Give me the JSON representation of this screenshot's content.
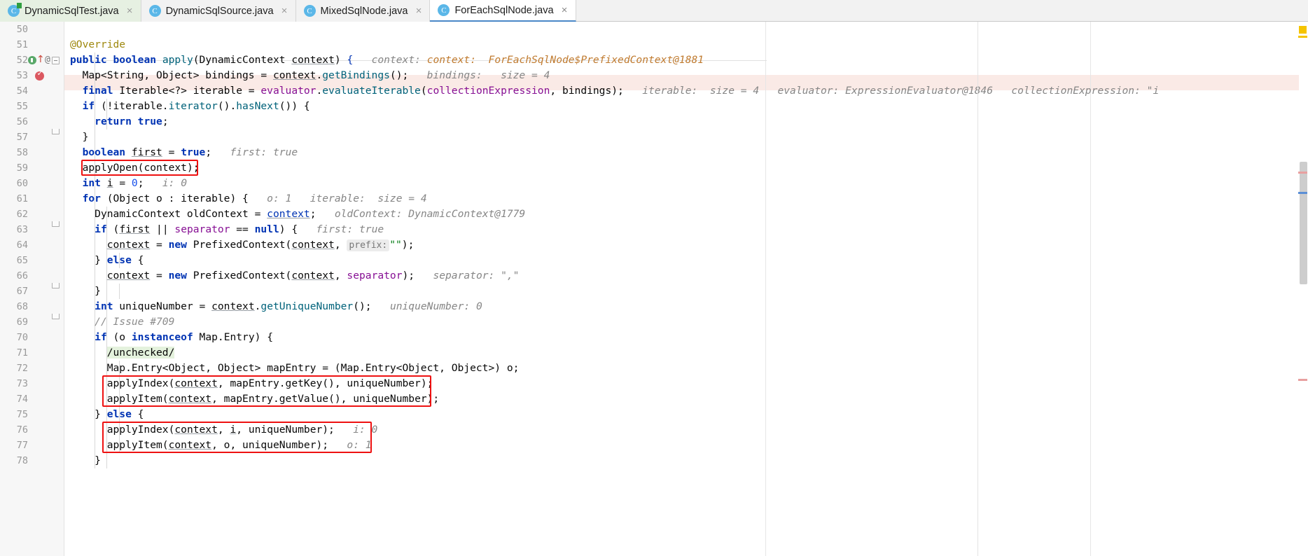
{
  "window": {
    "type": "ide-code-editor",
    "theme": "light"
  },
  "tabs": [
    {
      "label": "DynamicSqlTest.java",
      "icon": "java-class-icon",
      "state": "modified",
      "close": "×",
      "icon_letter": "C"
    },
    {
      "label": "DynamicSqlSource.java",
      "icon": "java-class-icon",
      "state": "normal",
      "close": "×",
      "icon_letter": "C"
    },
    {
      "label": "MixedSqlNode.java",
      "icon": "java-class-icon",
      "state": "normal",
      "close": "×",
      "icon_letter": "C"
    },
    {
      "label": "ForEachSqlNode.java",
      "icon": "java-class-icon",
      "state": "active",
      "close": "×",
      "icon_letter": "C"
    }
  ],
  "gutter": {
    "at_marker": "@",
    "line_numbers": [
      "50",
      "51",
      "52",
      "53",
      "54",
      "55",
      "56",
      "57",
      "58",
      "59",
      "60",
      "61",
      "62",
      "63",
      "64",
      "65",
      "66",
      "67",
      "68",
      "69",
      "70",
      "71",
      "72",
      "73",
      "74",
      "75",
      "76",
      "77",
      "78"
    ]
  },
  "code_lines": [
    {
      "n": "50",
      "indent": 0,
      "text": ""
    },
    {
      "n": "51",
      "indent": 1,
      "text": "@Override"
    },
    {
      "n": "52",
      "indent": 1,
      "text": "public boolean apply(DynamicContext context) {",
      "hint": "context:  ForEachSqlNode$PrefixedContext@1881"
    },
    {
      "n": "53",
      "indent": 2,
      "text": "Map<String, Object> bindings = context.getBindings();",
      "hint": "bindings:   size = 4",
      "executing": true
    },
    {
      "n": "54",
      "indent": 2,
      "text": "final Iterable<?> iterable = evaluator.evaluateIterable(collectionExpression, bindings);",
      "hint": "iterable:  size = 4   evaluator: ExpressionEvaluator@1846   collectionExpression: \"i"
    },
    {
      "n": "55",
      "indent": 2,
      "text": "if (!iterable.iterator().hasNext()) {"
    },
    {
      "n": "56",
      "indent": 3,
      "text": "return true;"
    },
    {
      "n": "57",
      "indent": 2,
      "text": "}"
    },
    {
      "n": "58",
      "indent": 2,
      "text": "boolean first = true;",
      "hint": "first: true"
    },
    {
      "n": "59",
      "indent": 2,
      "text": "applyOpen(context);",
      "boxed": true
    },
    {
      "n": "60",
      "indent": 2,
      "text": "int i = 0;",
      "hint": "i: 0"
    },
    {
      "n": "61",
      "indent": 2,
      "text": "for (Object o : iterable) {",
      "hint": "o: 1   iterable:  size = 4"
    },
    {
      "n": "62",
      "indent": 3,
      "text": "DynamicContext oldContext = context;",
      "hint": "oldContext: DynamicContext@1779"
    },
    {
      "n": "63",
      "indent": 3,
      "text": "if (first || separator == null) {",
      "hint": "first: true"
    },
    {
      "n": "64",
      "indent": 4,
      "text": "context = new PrefixedContext(context,  prefix: \"\");"
    },
    {
      "n": "65",
      "indent": 3,
      "text": "} else {"
    },
    {
      "n": "66",
      "indent": 4,
      "text": "context = new PrefixedContext(context, separator);",
      "hint": "separator: \",\""
    },
    {
      "n": "67",
      "indent": 3,
      "text": "}"
    },
    {
      "n": "68",
      "indent": 3,
      "text": "int uniqueNumber = context.getUniqueNumber();",
      "hint": "uniqueNumber: 0"
    },
    {
      "n": "69",
      "indent": 3,
      "text": "// Issue #709"
    },
    {
      "n": "70",
      "indent": 3,
      "text": "if (o instanceof Map.Entry) {"
    },
    {
      "n": "71",
      "indent": 4,
      "text": "/unchecked/"
    },
    {
      "n": "72",
      "indent": 4,
      "text": "Map.Entry<Object, Object> mapEntry = (Map.Entry<Object, Object>) o;"
    },
    {
      "n": "73",
      "indent": 4,
      "text": "applyIndex(context, mapEntry.getKey(), uniqueNumber);",
      "boxed": true
    },
    {
      "n": "74",
      "indent": 4,
      "text": "applyItem(context, mapEntry.getValue(), uniqueNumber);",
      "boxed": true
    },
    {
      "n": "75",
      "indent": 3,
      "text": "} else {"
    },
    {
      "n": "76",
      "indent": 4,
      "text": "applyIndex(context, i, uniqueNumber);",
      "hint": "i: 0",
      "boxed": true
    },
    {
      "n": "77",
      "indent": 4,
      "text": "applyItem(context, o, uniqueNumber);",
      "hint": "o: 1",
      "boxed": true
    },
    {
      "n": "78",
      "indent": 3,
      "text": "}"
    }
  ],
  "inline_hints": {
    "line52": "context:  ForEachSqlNode$PrefixedContext@1881",
    "line53": "bindings:   size = 4",
    "line54_iterable": "iterable:  size = 4",
    "line54_evaluator": "evaluator: ExpressionEvaluator@1846",
    "line54_collection": "collectionExpression: \"i",
    "line58": "first: true",
    "line60": "i: 0",
    "line61_o": "o: 1",
    "line61_iterable": "iterable:  size = 4",
    "line62": "oldContext: DynamicContext@1779",
    "line63": "first: true",
    "line64_param": "prefix:",
    "line66": "separator: \",\"",
    "line68": "uniqueNumber: 0",
    "line76": "i: 0",
    "line77": "o: 1"
  },
  "colors": {
    "keyword": "#0033b3",
    "string": "#067d17",
    "comment": "#8c8c8c",
    "annotation": "#9e880d",
    "field": "#871094",
    "method": "#00627a",
    "number": "#1750eb",
    "hint": "#868686",
    "execution_line_bg": "#faeae6",
    "annotation_box": "#ee1111",
    "tab_active_underline": "#4a88c7",
    "modified_tab_bg": "#e6f0e2",
    "warning_marker": "#f5c400"
  },
  "markers": {
    "warning_square": "warning-marker",
    "breakpoint_line": "53",
    "executing_line": "53"
  }
}
